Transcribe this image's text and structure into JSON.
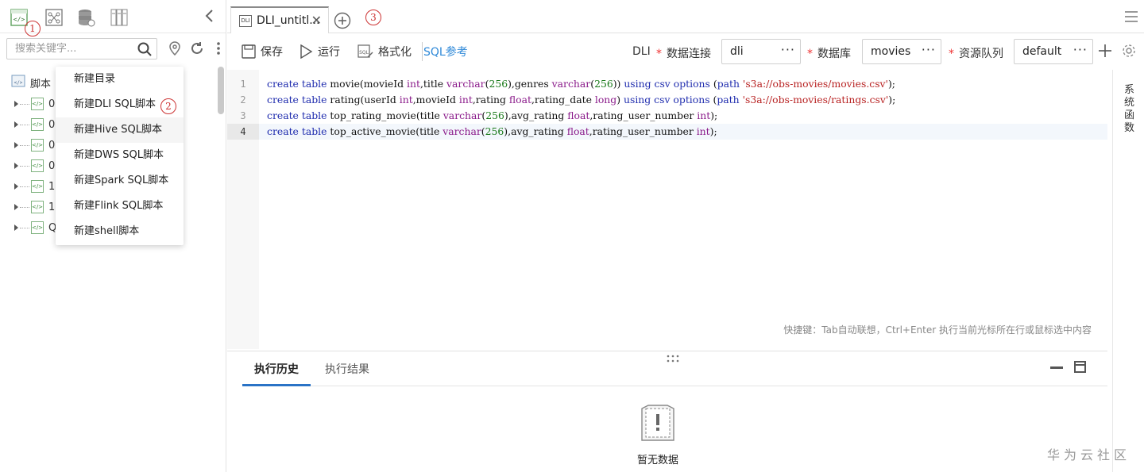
{
  "annotations": {
    "mark1": "1",
    "mark2": "2",
    "mark3": "3"
  },
  "left_panel": {
    "search_placeholder": "搜索关键字...",
    "tree_root": "脚本",
    "tree_items": [
      "0",
      "0",
      "0",
      "0",
      "1",
      "1",
      "Q"
    ]
  },
  "context_menu": {
    "items": [
      "新建目录",
      "新建DLI SQL脚本",
      "新建Hive SQL脚本",
      "新建DWS SQL脚本",
      "新建Spark SQL脚本",
      "新建Flink SQL脚本",
      "新建shell脚本"
    ],
    "highlighted_index": 2
  },
  "tabs": [
    {
      "label": "DLI_untitl...",
      "icon": "DLI"
    }
  ],
  "toolbar": {
    "save": "保存",
    "run": "运行",
    "format": "格式化",
    "sql_ref": "SQL参考",
    "engine": "DLI",
    "connection_label": "数据连接",
    "connection_value": "dli",
    "database_label": "数据库",
    "database_value": "movies",
    "queue_label": "资源队列",
    "queue_value": "default",
    "more": "···",
    "required": "*"
  },
  "editor": {
    "line_numbers": [
      "1",
      "2",
      "3",
      "4"
    ],
    "active_line": 4,
    "lines": [
      "create table movie(movieId int,title varchar(256),genres varchar(256)) using csv options (path 's3a://obs-movies/movies.csv');",
      "create table rating(userId int,movieId int,rating float,rating_date long) using csv options (path 's3a://obs-movies/ratings.csv');",
      "create table top_rating_movie(title varchar(256),avg_rating float,rating_user_number int);",
      "create table top_active_movie(title varchar(256),avg_rating float,rating_user_number int);"
    ],
    "hint": "快捷键：Tab自动联想，Ctrl+Enter 执行当前光标所在行或鼠标选中内容"
  },
  "side_panel": {
    "label": "系统函数"
  },
  "bottom_panel": {
    "tabs": [
      "执行历史",
      "执行结果"
    ],
    "active_tab": 0,
    "empty_text": "暂无数据"
  },
  "watermark": "华为云社区",
  "colors": {
    "accent": "#2a73c6",
    "link": "#2f89d8",
    "required": "#e33333",
    "annotation": "#cc3333"
  }
}
